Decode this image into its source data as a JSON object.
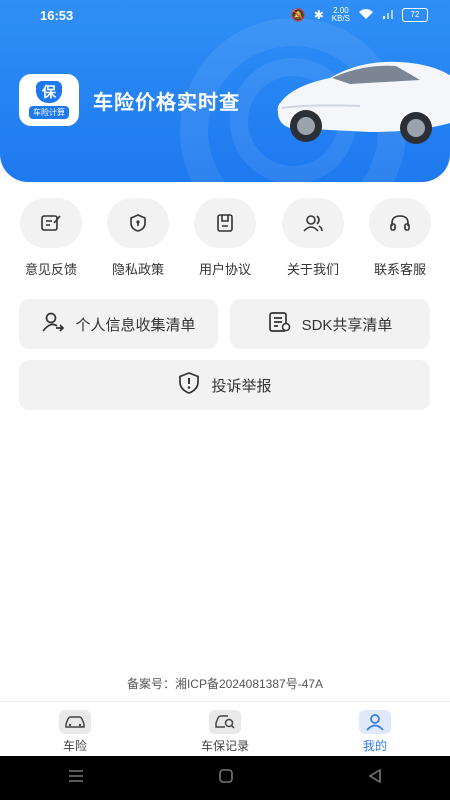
{
  "status_bar": {
    "time": "16:53",
    "network_speed": "2.00",
    "network_unit": "KB/S",
    "battery": "72"
  },
  "header": {
    "app_title": "车险价格实时查",
    "logo_char": "保",
    "logo_tag": "车险计算"
  },
  "quick_links": [
    {
      "label": "意见反馈",
      "icon": "feedback-icon"
    },
    {
      "label": "隐私政策",
      "icon": "privacy-shield-icon"
    },
    {
      "label": "用户协议",
      "icon": "agreement-icon"
    },
    {
      "label": "关于我们",
      "icon": "about-users-icon"
    },
    {
      "label": "联系客服",
      "icon": "headset-icon"
    }
  ],
  "cards": {
    "personal_info": "个人信息收集清单",
    "sdk_share": "SDK共享清单",
    "complaint": "投诉举报"
  },
  "record_number": "备案号：湘ICP备2024081387号-47A",
  "tabs": [
    {
      "label": "车险",
      "icon": "car-icon"
    },
    {
      "label": "车保记录",
      "icon": "record-search-icon"
    },
    {
      "label": "我的",
      "icon": "profile-icon"
    }
  ],
  "colors": {
    "brand": "#1e79ef",
    "active_tab": "#2f7bef"
  }
}
